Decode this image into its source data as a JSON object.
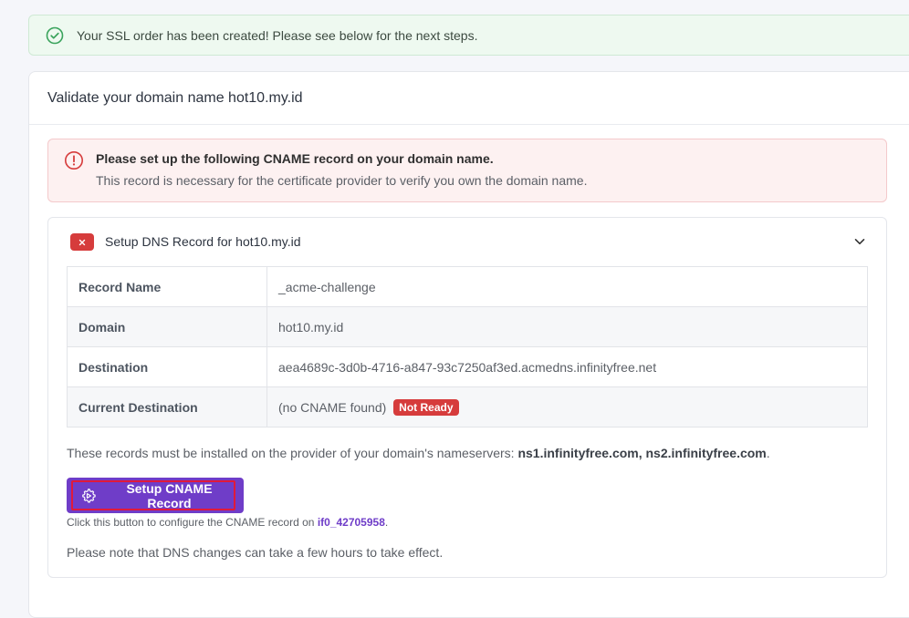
{
  "success_alert": {
    "text": "Your SSL order has been created! Please see below for the next steps."
  },
  "card": {
    "title": "Validate your domain name hot10.my.id"
  },
  "danger_alert": {
    "title": "Please set up the following CNAME record on your domain name.",
    "description": "This record is necessary for the certificate provider to verify you own the domain name."
  },
  "dns_panel": {
    "title": "Setup DNS Record for hot10.my.id",
    "rows": [
      {
        "label": "Record Name",
        "value": "_acme-challenge"
      },
      {
        "label": "Domain",
        "value": "hot10.my.id"
      },
      {
        "label": "Destination",
        "value": "aea4689c-3d0b-4716-a847-93c7250af3ed.acmedns.infinityfree.net"
      },
      {
        "label": "Current Destination",
        "value": "(no CNAME found)",
        "badge": "Not Ready"
      }
    ],
    "nameservers_prefix": "These records must be installed on the provider of your domain's nameservers:",
    "nameservers": "ns1.infinityfree.com, ns2.infinityfree.com",
    "nameservers_suffix": ".",
    "button_label": "Setup CNAME Record",
    "hint_prefix": "Click this button to configure the CNAME record on",
    "hint_account": "if0_42705958",
    "hint_suffix": ".",
    "note": "Please note that DNS changes can take a few hours to take effect."
  },
  "colors": {
    "accent": "#6f3dc8",
    "danger": "#d63c3c",
    "success": "#3aa35c"
  },
  "icons": {
    "success": "check-circle-icon",
    "danger": "exclamation-circle-icon",
    "status": "x-mark-icon",
    "collapse": "chevron-down-icon",
    "button": "gear-icon"
  }
}
